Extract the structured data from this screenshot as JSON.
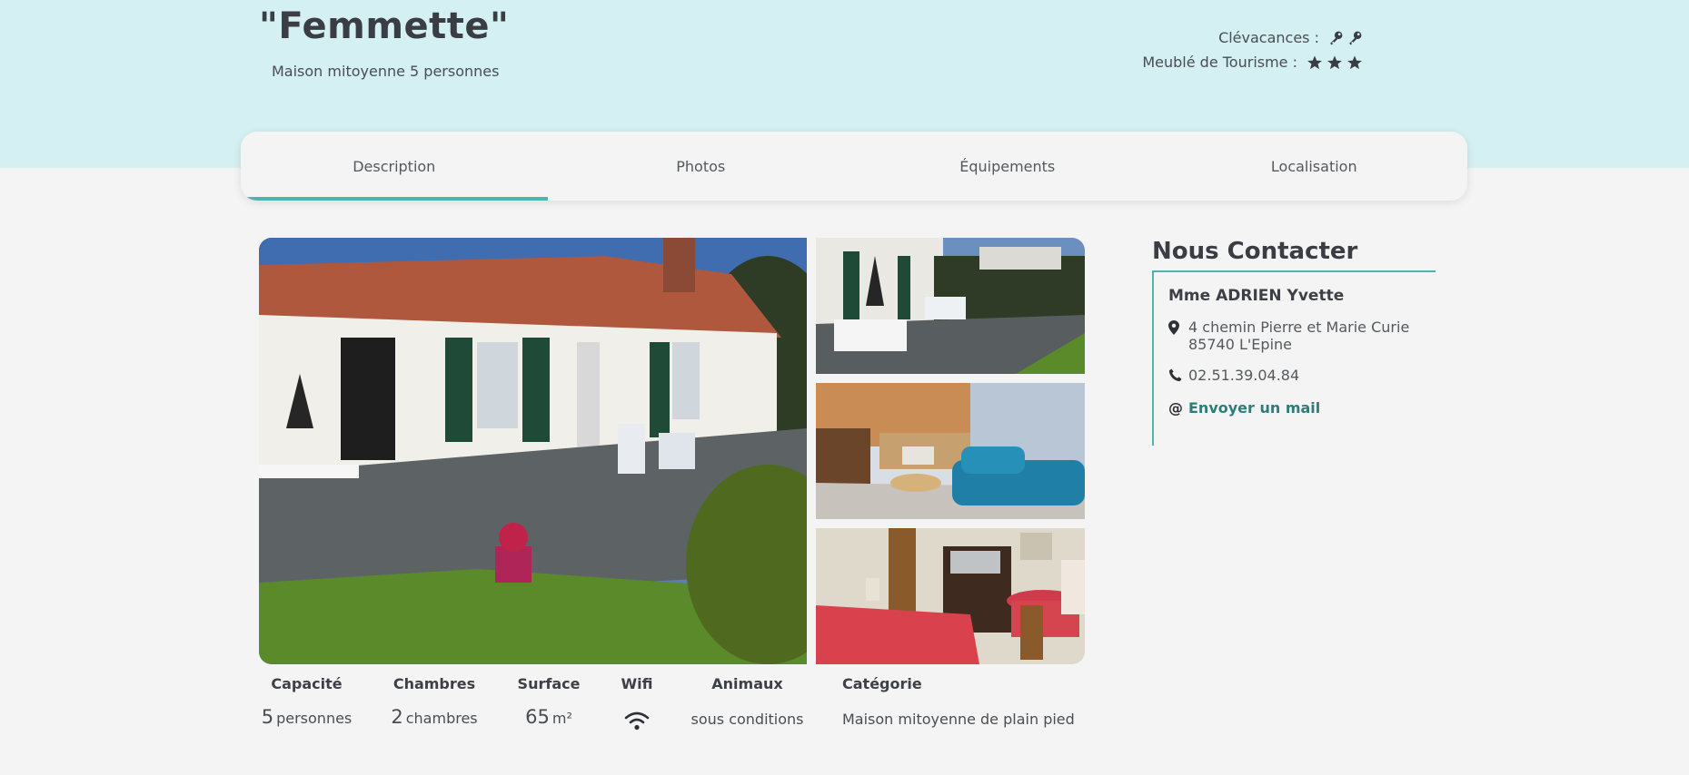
{
  "header": {
    "title": "\"Femmette\"",
    "subtitle": "Maison mitoyenne 5 personnes",
    "ratings": [
      {
        "label": "Clévacances :",
        "icon": "key-icon",
        "count": 2
      },
      {
        "label": "Meublé de Tourisme :",
        "icon": "star-icon",
        "count": 3
      }
    ]
  },
  "tabs": [
    {
      "label": "Description",
      "active": true
    },
    {
      "label": "Photos",
      "active": false
    },
    {
      "label": "Équipements",
      "active": false
    },
    {
      "label": "Localisation",
      "active": false
    }
  ],
  "stats": {
    "capacity": {
      "label": "Capacité",
      "value": "5",
      "unit": "personnes"
    },
    "rooms": {
      "label": "Chambres",
      "value": "2",
      "unit": "chambres"
    },
    "surface": {
      "label": "Surface",
      "value": "65",
      "unit": "m²"
    },
    "wifi": {
      "label": "Wifi",
      "icon": "wifi-icon"
    },
    "animals": {
      "label": "Animaux",
      "value": "sous conditions"
    },
    "category": {
      "label": "Catégorie",
      "value": "Maison mitoyenne de plain pied"
    }
  },
  "contact": {
    "title": "Nous Contacter",
    "name": "Mme ADRIEN Yvette",
    "address_line1": "4 chemin Pierre et Marie Curie",
    "address_line2": "85740 L'Epine",
    "phone": "02.51.39.04.84",
    "mail_label": "Envoyer un mail"
  },
  "colors": {
    "accent": "#4fb3b0",
    "hero_bg": "#d4f0f2",
    "page_bg": "#f4f4f4",
    "link": "#2f7d7a"
  }
}
